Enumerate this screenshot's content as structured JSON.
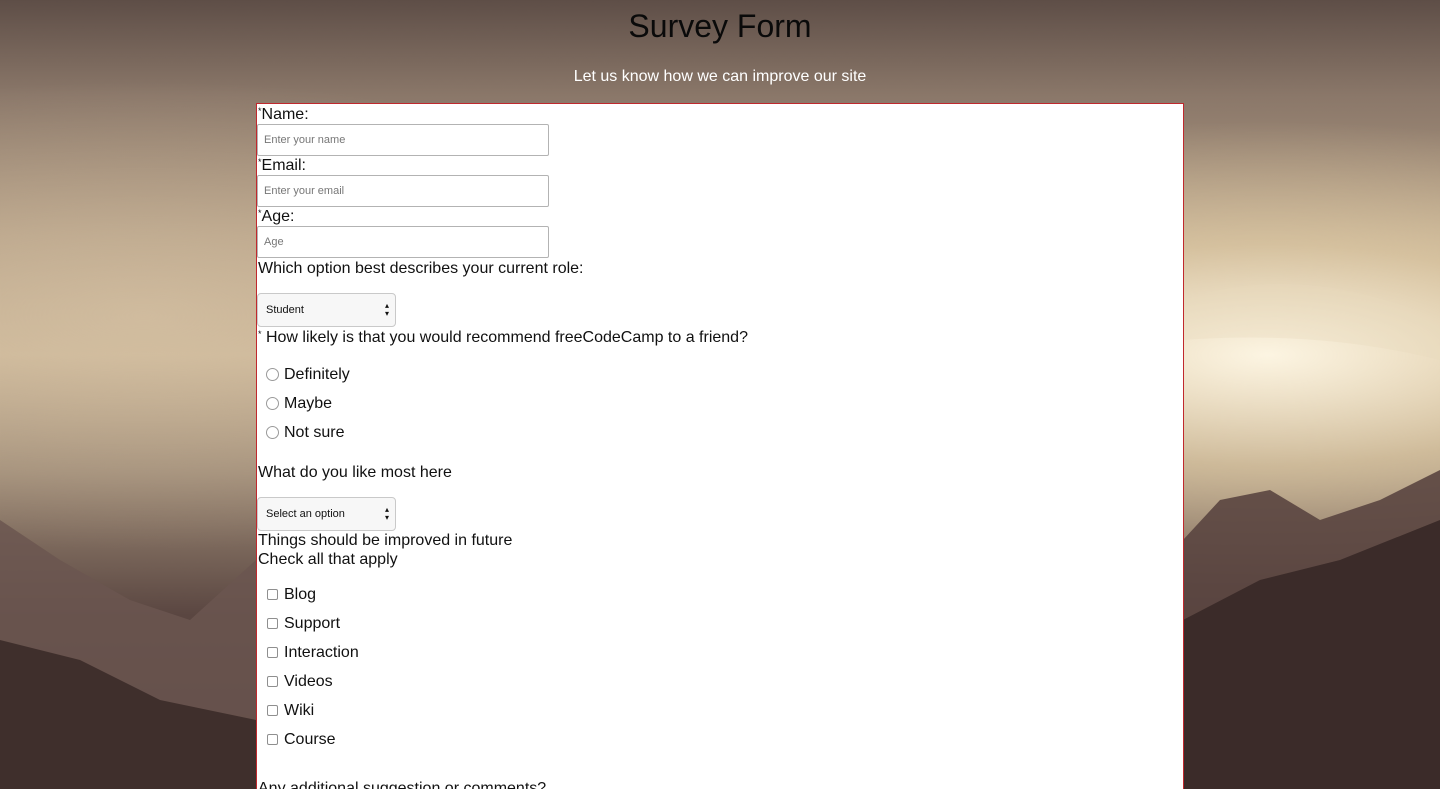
{
  "header": {
    "title": "Survey Form",
    "subtitle": "Let us know how we can improve our site"
  },
  "form": {
    "name": {
      "required_mark": "*",
      "label": "Name:",
      "placeholder": "Enter your name"
    },
    "email": {
      "required_mark": "*",
      "label": "Email:",
      "placeholder": "Enter your email"
    },
    "age": {
      "required_mark": "*",
      "label": "Age:",
      "placeholder": "Age"
    },
    "role": {
      "label": "Which option best describes your current role:",
      "selected": "Student",
      "arrow": "▲▼"
    },
    "recommend": {
      "required_mark": "*",
      "label": " How likely is that you would recommend freeCodeCamp to a friend?",
      "options": [
        "Definitely",
        "Maybe",
        "Not sure"
      ]
    },
    "like_most": {
      "label": "What do you like most here",
      "selected": "Select an option",
      "arrow": "▲▼"
    },
    "improve": {
      "label": "Things should be improved in future",
      "sublabel": "Check all that apply",
      "options": [
        "Blog",
        "Support",
        "Interaction",
        "Videos",
        "Wiki",
        "Course"
      ]
    },
    "comments": {
      "label": "Any additional suggestion or comments?"
    }
  },
  "colors": {
    "form_border": "#c0282d",
    "subtitle": "#ffffff"
  }
}
